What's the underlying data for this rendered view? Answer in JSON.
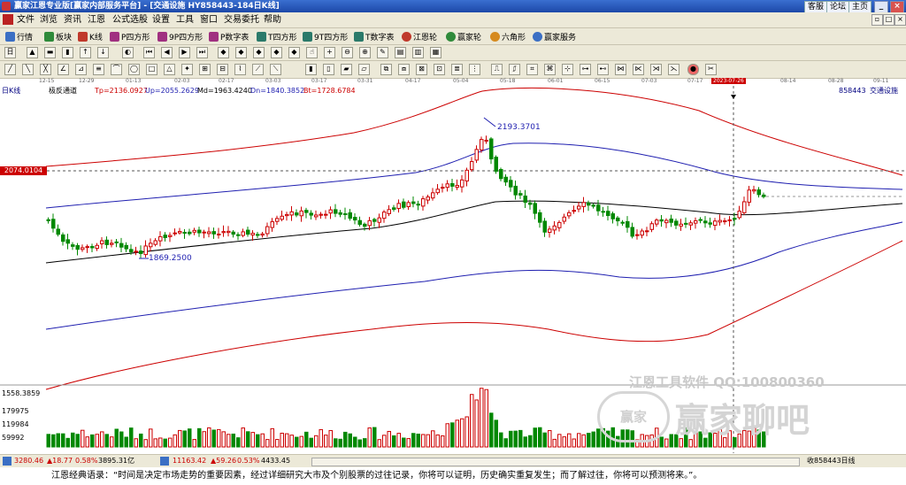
{
  "window": {
    "title": "赢家江恩专业版[赢家内部服务平台] - [交通设施  HY858443-184日K线]",
    "buttons": [
      "客服",
      "论坛",
      "主页"
    ]
  },
  "menu": [
    "文件",
    "浏览",
    "资讯",
    "江恩",
    "公式选股",
    "设置",
    "工具",
    "窗口",
    "交易委托",
    "帮助"
  ],
  "toolbar1": [
    "行情",
    "板块",
    "K线",
    "P四方形",
    "9P四方形",
    "P数字表",
    "T四方形",
    "9T四方形",
    "T数字表",
    "江恩轮",
    "赢家轮",
    "六角形",
    "赢家服务"
  ],
  "chart_data": {
    "type": "candlestick",
    "period_label": "日K线",
    "security_code": "858443",
    "security_name": "交通设施",
    "indicator": {
      "name": "极反通道",
      "Tp": "2136.0927",
      "Up": "2055.2629",
      "Md": "1963.4240",
      "Dn": "1840.3852",
      "Bt": "1728.6784"
    },
    "date_ticks": [
      "12-15",
      "12-29",
      "01-13",
      "02-03",
      "02-17",
      "03-03",
      "03-17",
      "03-31",
      "04-17",
      "05-04",
      "05-18",
      "06-01",
      "06-15",
      "07-03",
      "07-17",
      "2023-07-26",
      "08-14",
      "08-28",
      "09-11"
    ],
    "crosshair_date": "2023-07-26",
    "crosshair_price": "2074.0104",
    "annotations": [
      {
        "label": "2193.3701",
        "type": "high"
      },
      {
        "label": "1869.2500",
        "type": "low"
      }
    ],
    "volume_labels": [
      "1558.3859",
      "179975",
      "119984",
      "59992"
    ],
    "series": [
      {
        "name": "Tp",
        "color": "#cc0000"
      },
      {
        "name": "Up",
        "color": "#1f1fb0"
      },
      {
        "name": "Md",
        "color": "#000000"
      },
      {
        "name": "Dn",
        "color": "#1f1fb0"
      },
      {
        "name": "Bt",
        "color": "#cc0000"
      }
    ]
  },
  "watermark": {
    "line1": "江恩工具软件  QQ:100800360",
    "logo": "赢家",
    "line2": "赢家聊吧"
  },
  "status": {
    "index1": "3280.46",
    "chg1": "▲18.77",
    "pct1": "0.58%",
    "amt1": "3895.31亿",
    "index2": "11163.42",
    "chg2": "▲59.26",
    "pct2": "0.53%",
    "amt2": "4433.45",
    "right": "收858443日线"
  },
  "quote": "江恩经典语录：“时间是决定市场走势的重要因素，经过详细研究大市及个别股票的过往记录，你将可以证明，历史确实重复发生；而了解过往，你将可以预测将来。”。"
}
